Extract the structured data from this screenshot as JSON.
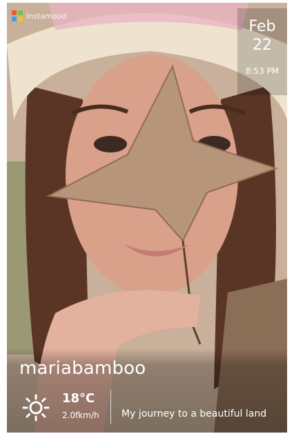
{
  "app": {
    "logo_text": "Instamood",
    "logo_icon": "app-logo-icon"
  },
  "date": {
    "month": "Feb",
    "day": "22",
    "time": "8:53 PM"
  },
  "post": {
    "username": "mariabamboo",
    "weather": {
      "icon": "sun-icon",
      "temperature": "18°C",
      "wind": "2.0fkm/h"
    },
    "caption": "My journey to a beautiful land"
  }
}
